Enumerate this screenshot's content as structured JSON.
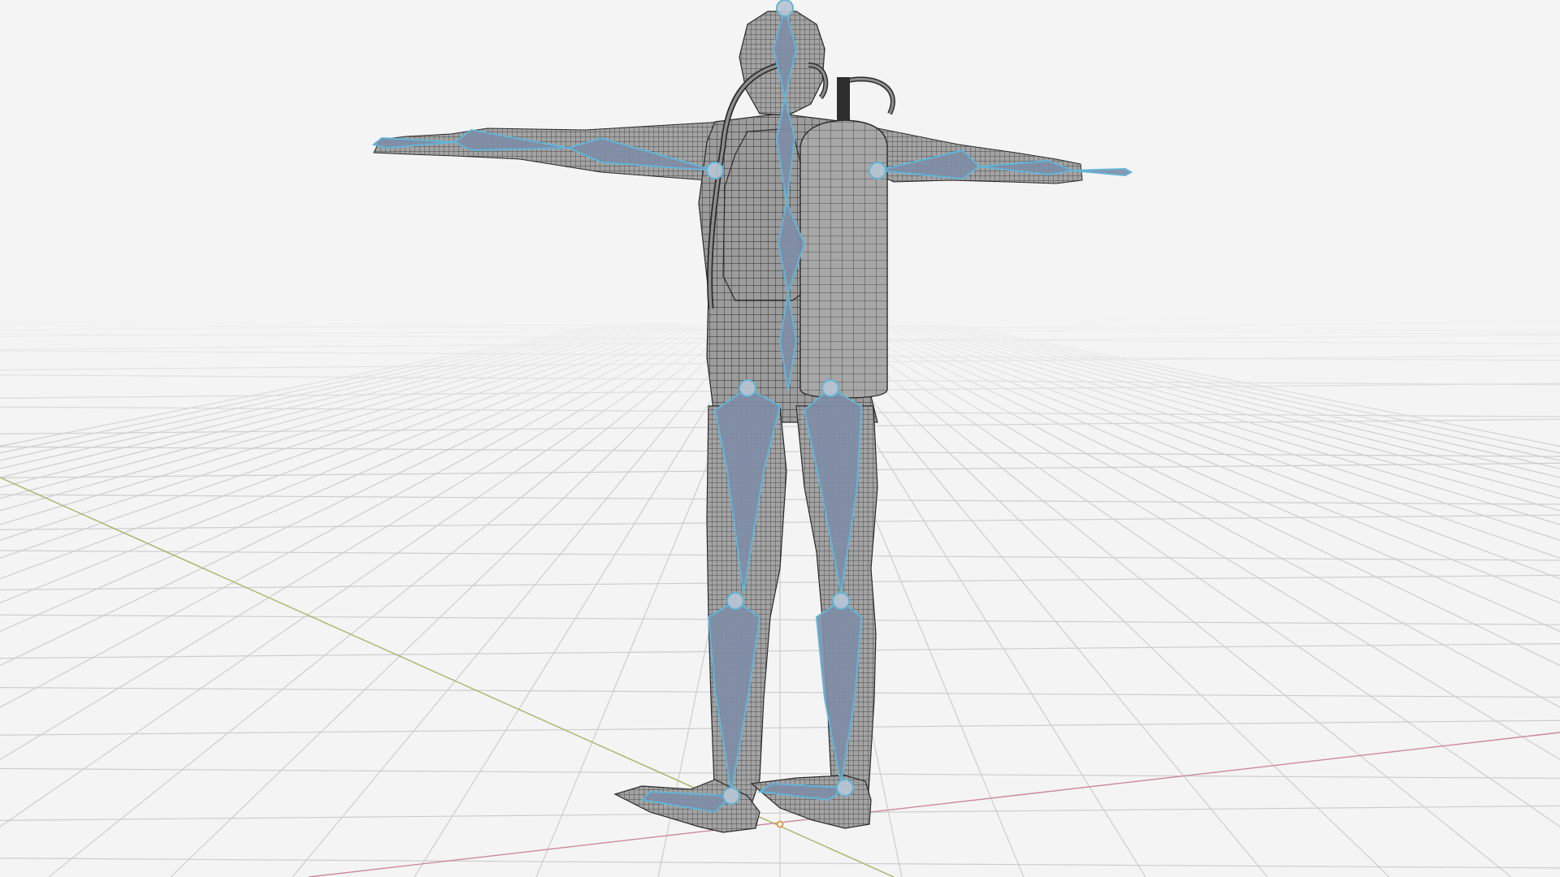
{
  "viewport": {
    "background": "#f4f4f4",
    "view": "3d-perspective",
    "grid_visible": true
  },
  "colors": {
    "grid": "#cfcfcf",
    "axis_x": "#c98a9a",
    "axis_y": "#a9b36a",
    "mesh_fill": "#9b9b9b",
    "mesh_wire": "#2b2b2b",
    "bone_fill": "#7f8da6",
    "bone_outline": "#63b4d6",
    "spine_accent": "#8fc2b8",
    "origin": "#e08a1e"
  },
  "scene": {
    "object": "rigged-diver-character",
    "pose": "T-pose",
    "equipment": [
      "scuba-tank",
      "backpack-harness",
      "regulator-hose",
      "fins"
    ],
    "armature": "bones-visible",
    "display": "wireframe-on-shaded"
  }
}
